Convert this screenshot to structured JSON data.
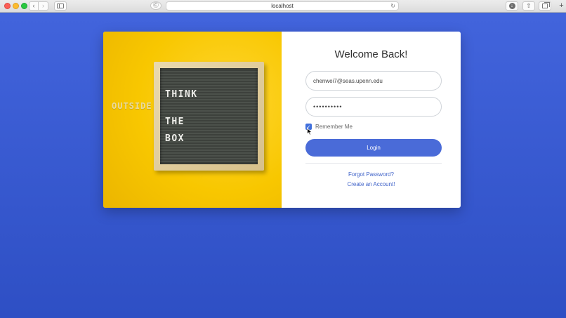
{
  "browser": {
    "url": "localhost",
    "back_glyph": "‹",
    "forward_glyph": "›",
    "reload_glyph": "↻",
    "reader_glyph": "Ⓒ",
    "share_glyph": "⇧",
    "download_glyph": "↓",
    "newtab_glyph": "+"
  },
  "hero": {
    "outside_text": "OUTSIDE",
    "board_lines": [
      "THINK",
      "THE",
      "BOX"
    ]
  },
  "form": {
    "title": "Welcome Back!",
    "email_value": "chenwei7@seas.upenn.edu",
    "password_value": "••••••••••",
    "remember_label": "Remember Me",
    "remember_checked": true,
    "checkbox_glyph": "✓",
    "login_label": "Login",
    "forgot_label": "Forgot Password?",
    "create_label": "Create an Account!"
  },
  "colors": {
    "background": "#3a5fd0",
    "primary_button": "#4a6bd8",
    "link": "#3f62c8",
    "hero_yellow": "#f8c700"
  }
}
